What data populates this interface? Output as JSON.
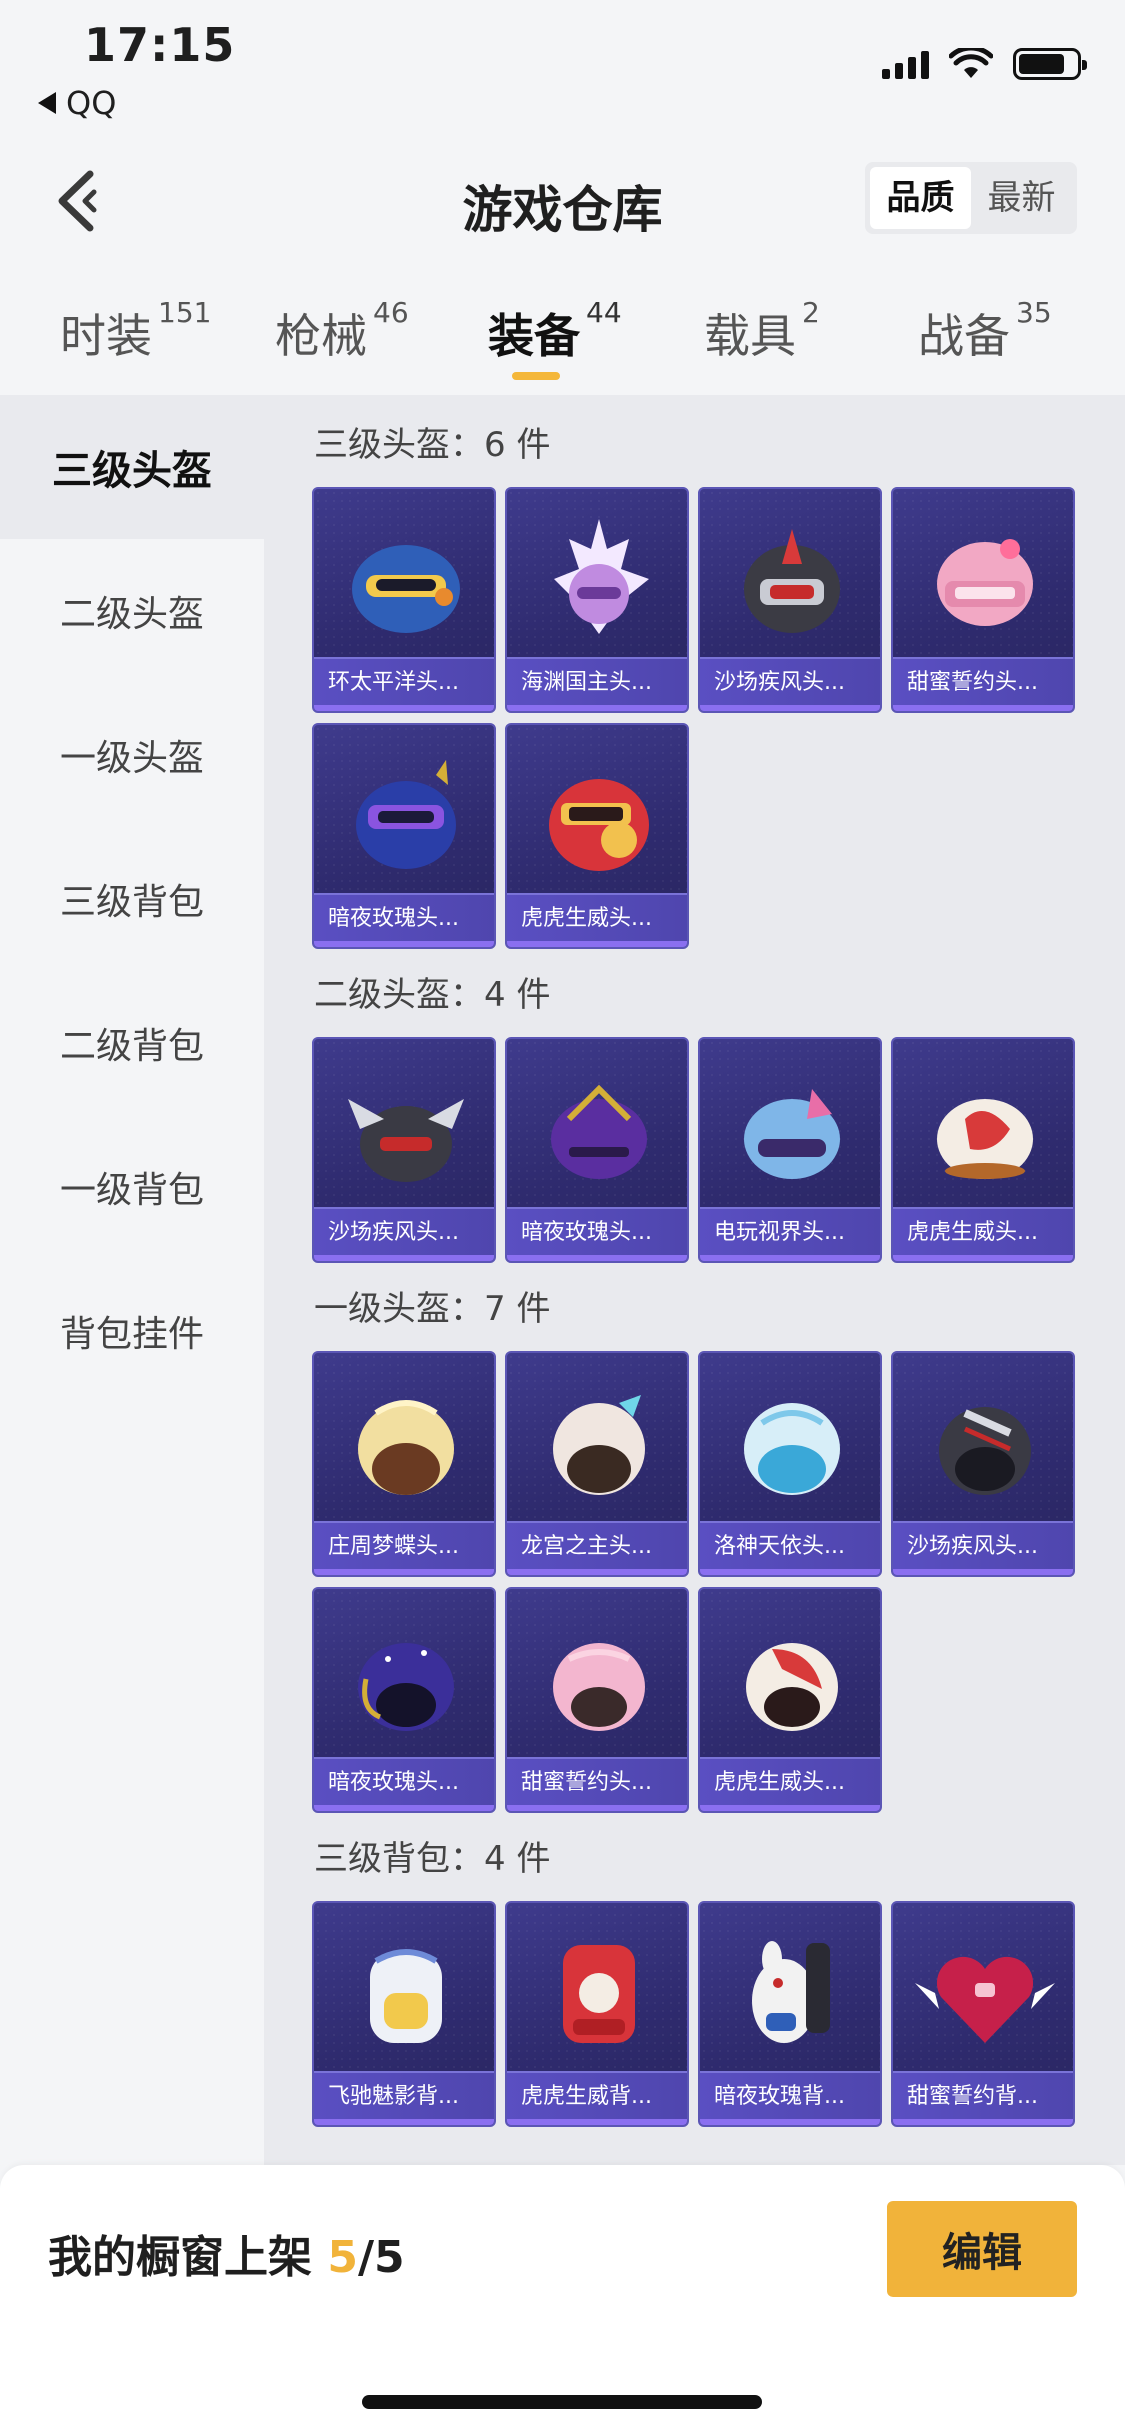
{
  "status_bar": {
    "time": "17:15",
    "back_app": "QQ"
  },
  "header": {
    "title": "游戏仓库",
    "sort_options": [
      "品质",
      "最新"
    ],
    "sort_active": "品质"
  },
  "tabs": [
    {
      "label": "时装",
      "count": "151"
    },
    {
      "label": "枪械",
      "count": "46"
    },
    {
      "label": "装备",
      "count": "44"
    },
    {
      "label": "载具",
      "count": "2"
    },
    {
      "label": "战备",
      "count": "35"
    }
  ],
  "active_tab": "装备",
  "sidebar": {
    "items": [
      "三级头盔",
      "二级头盔",
      "一级头盔",
      "三级背包",
      "二级背包",
      "一级背包",
      "背包挂件"
    ]
  },
  "sections": [
    {
      "title": "三级头盔：6 件",
      "items": [
        "环太平洋头...",
        "海渊国主头...",
        "沙场疾风头...",
        "甜蜜誓约头...",
        "暗夜玫瑰头...",
        "虎虎生威头..."
      ]
    },
    {
      "title": "二级头盔：4 件",
      "items": [
        "沙场疾风头...",
        "暗夜玫瑰头...",
        "电玩视界头...",
        "虎虎生威头..."
      ]
    },
    {
      "title": "一级头盔：7 件",
      "items": [
        "庄周梦蝶头...",
        "龙宫之主头...",
        "洛神天依头...",
        "沙场疾风头...",
        "暗夜玫瑰头...",
        "甜蜜誓约头...",
        "虎虎生威头..."
      ]
    },
    {
      "title": "三级背包：4 件",
      "items": [
        "飞驰魅影背...",
        "虎虎生威背...",
        "暗夜玫瑰背...",
        "甜蜜誓约背..."
      ]
    }
  ],
  "bottom": {
    "showcase_label": "我的橱窗上架 ",
    "showcase_count": "5",
    "showcase_total": "/5",
    "edit_label": "编辑"
  },
  "colors": {
    "accent": "#f1b33a",
    "card_bg": "#3f3b8d",
    "card_label": "#5a4fc2"
  }
}
